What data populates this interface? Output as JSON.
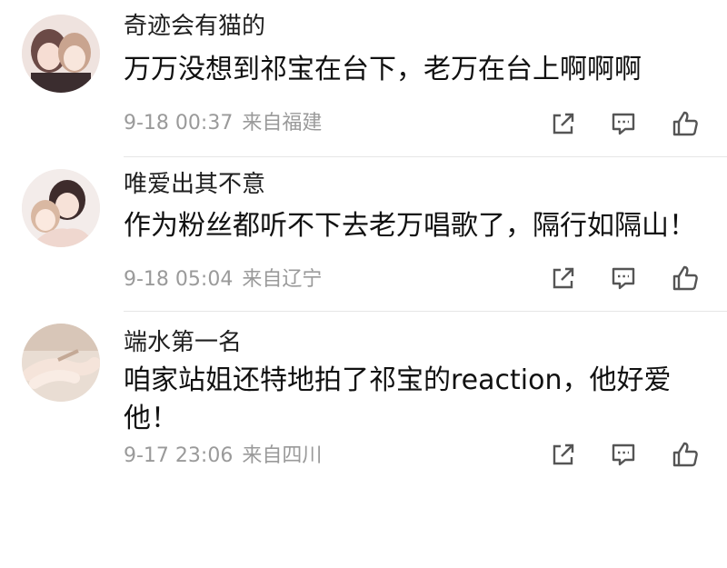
{
  "comments": [
    {
      "username": "奇迹会有猫的",
      "text": "万万没想到祁宝在台下，老万在台上啊啊啊",
      "time": "9-18 00:37",
      "location": "来自福建",
      "avatar_icon": "avatar-illustration-icon"
    },
    {
      "username": "唯爱出其不意",
      "text": "作为粉丝都听不下去老万唱歌了，隔行如隔山！",
      "time": "9-18 05:04",
      "location": "来自辽宁",
      "avatar_icon": "avatar-illustration-icon"
    },
    {
      "username": "端水第一名",
      "text": "咱家站姐还特地拍了祁宝的reaction，他好爱他！",
      "time": "9-17 23:06",
      "location": "来自四川",
      "avatar_icon": "avatar-illustration-icon"
    }
  ],
  "icons": {
    "share": "share-icon",
    "reply": "comment-icon",
    "like": "thumbs-up-icon"
  },
  "colors": {
    "text": "#111111",
    "username": "#1f1f1f",
    "meta": "#9a9a9a",
    "icon": "#555555",
    "divider": "#e6e6e6"
  }
}
